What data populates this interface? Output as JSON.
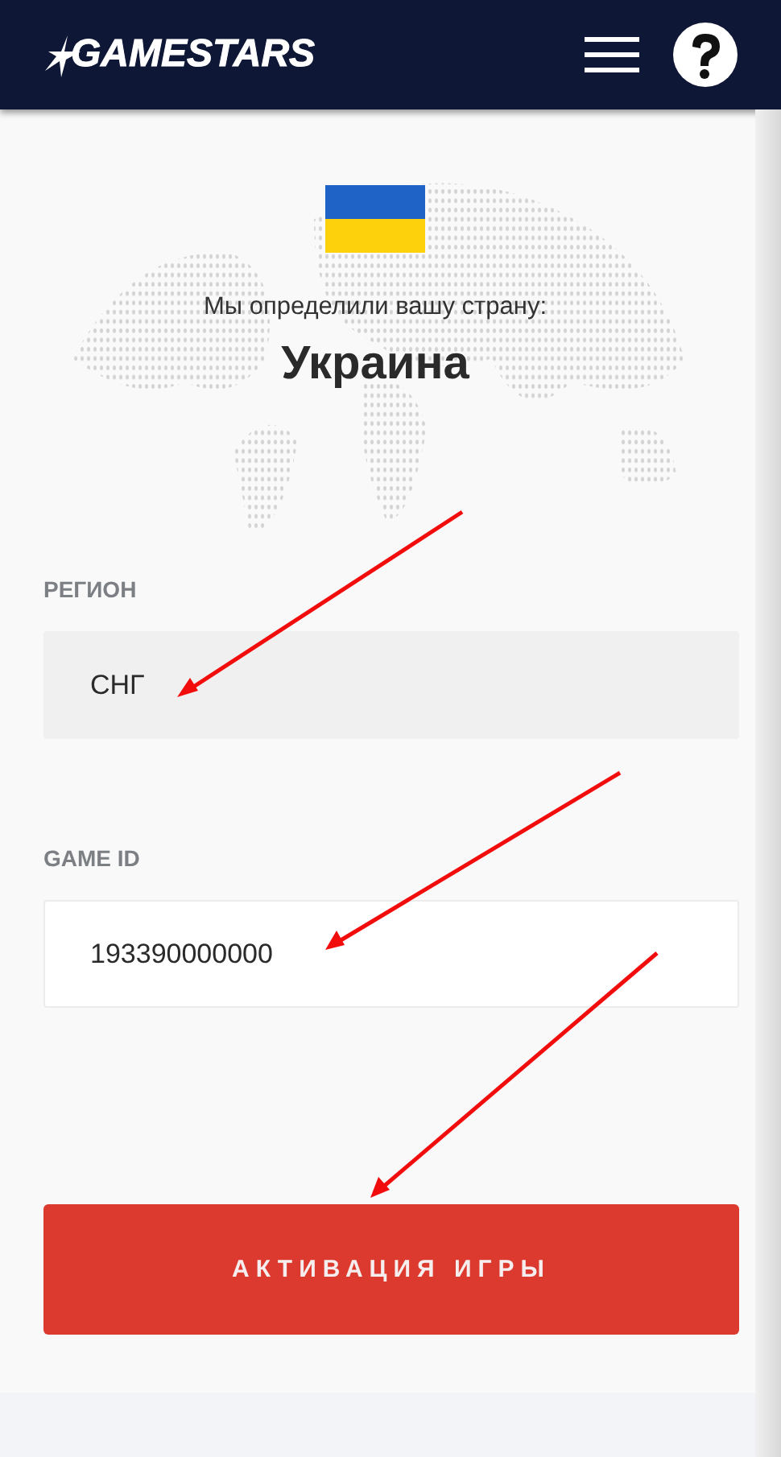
{
  "header": {
    "logo": "GAMESTARS"
  },
  "country": {
    "caption": "Мы определили вашу страну:",
    "name": "Украина"
  },
  "fields": [
    {
      "label": "РЕГИОН",
      "value": "СНГ",
      "disabled": true
    },
    {
      "label": "GAME ID",
      "value": "193390000000",
      "disabled": false
    }
  ],
  "button": {
    "label": "АКТИВАЦИЯ ИГРЫ"
  }
}
